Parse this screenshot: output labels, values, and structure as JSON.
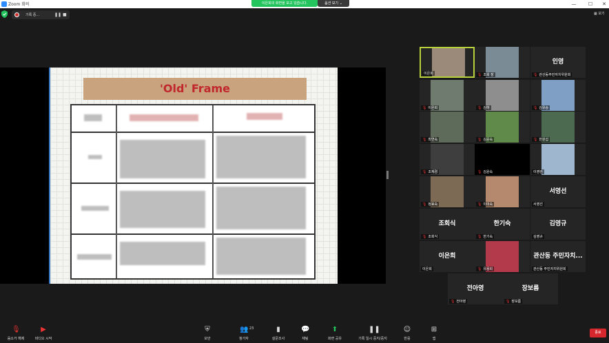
{
  "window": {
    "title": "Zoom 회의",
    "minimize": "—",
    "maximize": "☐",
    "close": "✕"
  },
  "share_banner": "이은희의 화면을 보고 있습니다.",
  "view_options": "옵션 보기 ⌄",
  "recording": {
    "label": "기록 중..."
  },
  "view_button": "보기",
  "slide": {
    "title": "'Old' Frame"
  },
  "participants": [
    {
      "name": "이은희",
      "display": "",
      "muted": false,
      "photo": "#9b8a7a",
      "active": true
    },
    {
      "name": "조희 장",
      "display": "",
      "muted": true,
      "photo": "#7a8b95"
    },
    {
      "name": "관산동주민자치위원회",
      "display": "인영",
      "muted": true,
      "photo": ""
    },
    {
      "name": "이은희",
      "display": "",
      "muted": true,
      "photo": "#6f7b6e"
    },
    {
      "name": "김하",
      "display": "",
      "muted": true,
      "photo": "#8e8e8e"
    },
    {
      "name": "김유승",
      "display": "",
      "muted": true,
      "photo": "#7fa0c4"
    },
    {
      "name": "최연숙",
      "display": "",
      "muted": true,
      "photo": "#5e6a5a"
    },
    {
      "name": "김윤숙",
      "display": "",
      "muted": true,
      "photo": "#5f8a4a"
    },
    {
      "name": "한원섭",
      "display": "",
      "muted": true,
      "photo": "#4c6a4f"
    },
    {
      "name": "조재경",
      "display": "",
      "muted": true,
      "photo": "#3e3e3e"
    },
    {
      "name": "김윤숙",
      "display": "",
      "muted": true,
      "photo": "#000000"
    },
    {
      "name": "이영란",
      "display": "",
      "muted": false,
      "photo": "#9fb6cf"
    },
    {
      "name": "정효숙",
      "display": "",
      "muted": true,
      "photo": "#7d6a55"
    },
    {
      "name": "이미숙",
      "display": "",
      "muted": true,
      "photo": "#b5896d"
    },
    {
      "name": "서영선",
      "display": "서영선",
      "muted": false,
      "photo": ""
    },
    {
      "name": "조회식",
      "display": "조회식",
      "muted": true,
      "photo": ""
    },
    {
      "name": "한기숙",
      "display": "한기숙",
      "muted": true,
      "photo": ""
    },
    {
      "name": "김영규",
      "display": "김영규",
      "muted": false,
      "photo": ""
    },
    {
      "name": "이은희",
      "display": "이은희",
      "muted": false,
      "photo": ""
    },
    {
      "name": "유용희",
      "display": "",
      "muted": true,
      "photo": "#b23a4a"
    },
    {
      "name": "관산동 주민자치위원회",
      "display": "관산동 주민자치...",
      "muted": false,
      "photo": ""
    },
    {
      "name": "전아영",
      "display": "전아영",
      "muted": true,
      "photo": ""
    },
    {
      "name": "장보름",
      "display": "장보름",
      "muted": true,
      "photo": ""
    }
  ],
  "toolbar": {
    "mute": "음소거 해제",
    "video": "비디오 시작",
    "security": "보안",
    "participants": "참가자",
    "participants_count": "23",
    "polls": "설문조사",
    "chat": "채팅",
    "share": "화면 공유",
    "record": "기록 일시 중지/중지",
    "reactions": "반응",
    "apps": "앱",
    "end": "종료"
  },
  "colors": {
    "accent": "#2d8cff",
    "share_green": "#23c35e",
    "end_red": "#d6272e",
    "active_speaker": "#b7d23a"
  }
}
